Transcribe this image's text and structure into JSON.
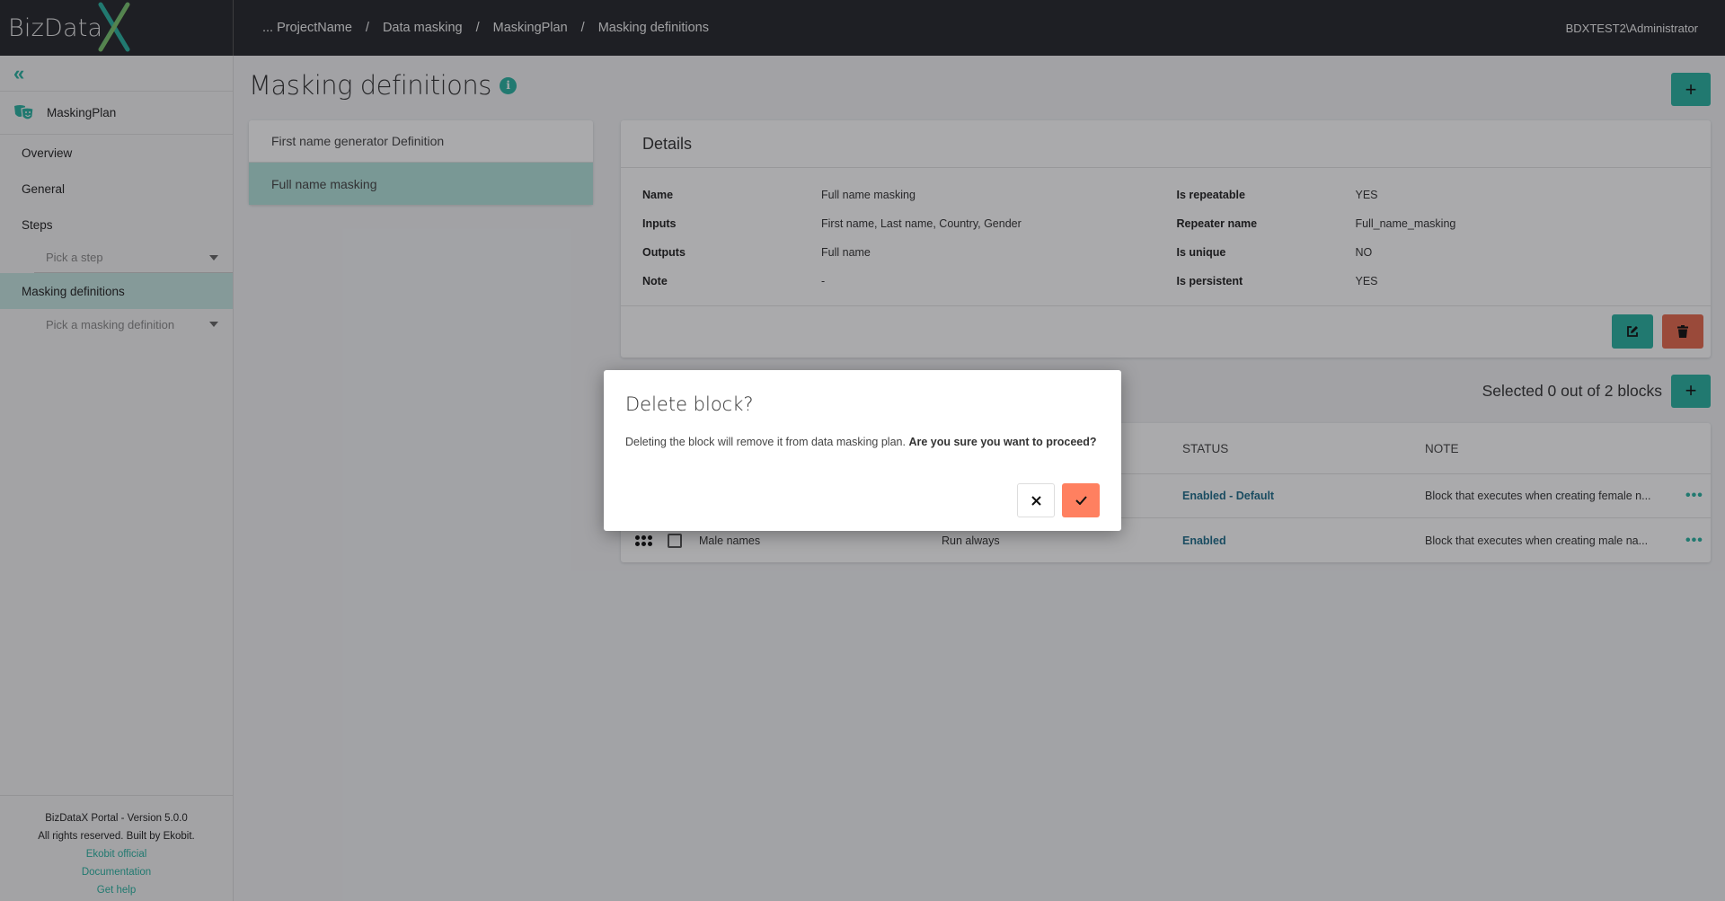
{
  "header": {
    "logo_text": "BizData",
    "breadcrumb": [
      "... ProjectName",
      "Data masking",
      "MaskingPlan",
      "Masking definitions"
    ],
    "breadcrumb_separator": "/",
    "user": "BDXTEST2\\Administrator"
  },
  "sidebar": {
    "plan_name": "MaskingPlan",
    "items": [
      {
        "label": "Overview"
      },
      {
        "label": "General"
      },
      {
        "label": "Steps"
      },
      {
        "label": "Masking definitions"
      }
    ],
    "steps_picker_placeholder": "Pick a step",
    "definition_picker_placeholder": "Pick a masking definition",
    "footer": {
      "version": "BizDataX Portal - Version 5.0.0",
      "rights": "All rights reserved. Built by Ekobit.",
      "links": [
        "Ekobit official",
        "Documentation",
        "Get help"
      ]
    }
  },
  "main": {
    "title": "Masking definitions",
    "info_icon": "i",
    "add_label": "+",
    "definitions": [
      {
        "label": "First name generator Definition",
        "active": false
      },
      {
        "label": "Full name masking",
        "active": true
      }
    ],
    "details": {
      "title": "Details",
      "left": [
        {
          "label": "Name",
          "value": "Full name masking"
        },
        {
          "label": "Inputs",
          "value": "First name, Last name, Country, Gender"
        },
        {
          "label": "Outputs",
          "value": "Full name"
        },
        {
          "label": "Note",
          "value": "-"
        }
      ],
      "right": [
        {
          "label": "Is repeatable",
          "value": "YES"
        },
        {
          "label": "Repeater name",
          "value": "Full_name_masking"
        },
        {
          "label": "Is unique",
          "value": "NO"
        },
        {
          "label": "Is persistent",
          "value": "YES"
        }
      ]
    },
    "blocks": {
      "selected_text": "Selected 0 out of 2 blocks",
      "columns": {
        "status": "STATUS",
        "note": "NOTE"
      },
      "rows": [
        {
          "name": "",
          "condition": "",
          "status": "Enabled - Default",
          "note": "Block that executes when creating female n...",
          "menu": "•••"
        },
        {
          "name": "Male names",
          "condition": "Run always",
          "status": "Enabled",
          "note": "Block that executes when creating male na...",
          "menu": "•••"
        }
      ]
    }
  },
  "modal": {
    "title": "Delete block?",
    "body": "Deleting the block will remove it from data masking plan.",
    "body_bold": "Are you sure you want to proceed?",
    "cancel_icon": "✕",
    "confirm_icon": "✓"
  },
  "colors": {
    "accent": "#2ab3a1",
    "danger": "#e66a4d",
    "confirm": "#ff8060",
    "topbar": "#24262b"
  }
}
